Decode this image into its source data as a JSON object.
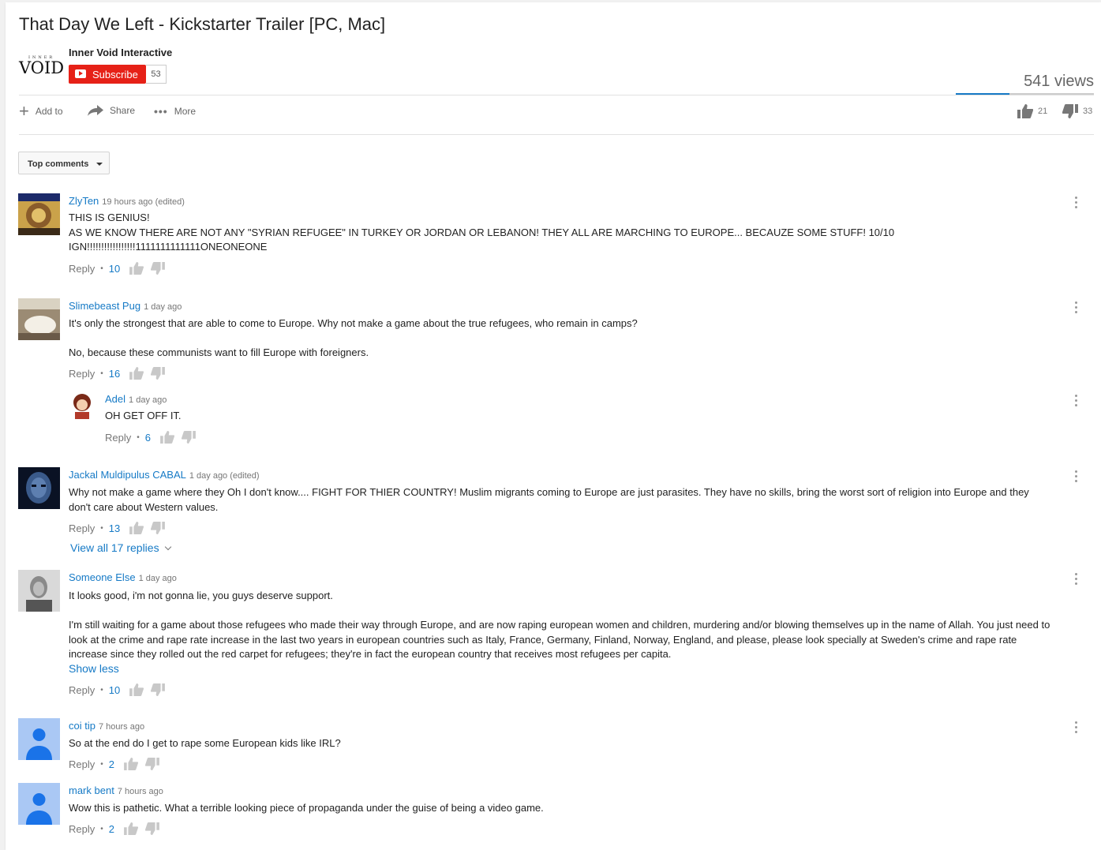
{
  "video": {
    "title": "That Day We Left - Kickstarter Trailer [PC, Mac]",
    "views": "541 views",
    "likes": "21",
    "dislikes": "33",
    "like_ratio": 0.39
  },
  "channel": {
    "name": "Inner Void Interactive",
    "logo_small": "INNER",
    "logo_word": "VOID",
    "subscribe_label": "Subscribe",
    "subscriber_count": "53"
  },
  "actions": {
    "add_to": "Add to",
    "share": "Share",
    "more": "More"
  },
  "sort": {
    "label": "Top comments"
  },
  "comments": [
    {
      "author": "ZlyTen",
      "time": "19 hours ago (edited)",
      "lines": [
        "THIS IS GENIUS!",
        "AS WE KNOW THERE ARE NOT ANY \"SYRIAN REFUGEE\" IN TURKEY OR JORDAN OR LEBANON! THEY ALL ARE MARCHING TO EUROPE... BECAUZE SOME STUFF! 10/10",
        "IGN!!!!!!!!!!!!!!!!!1111111111111ONEONEONE"
      ],
      "reply_label": "Reply",
      "likes": "10"
    },
    {
      "author": "Slimebeast Pug",
      "time": "1 day ago",
      "lines": [
        "It's only the strongest that are able to come to Europe. Why not make a game about the true refugees, who remain in camps?",
        "",
        "No, because these communists want to fill Europe with foreigners."
      ],
      "reply_label": "Reply",
      "likes": "16",
      "reply": {
        "author": "Adel",
        "time": "1 day ago",
        "text": "OH GET OFF IT.",
        "reply_label": "Reply",
        "likes": "6"
      }
    },
    {
      "author": "Jackal Muldipulus CABAL",
      "time": "1 day ago (edited)",
      "lines": [
        "Why not make a game where they Oh I don't know.... FIGHT FOR THIER COUNTRY! Muslim migrants coming to Europe are just parasites. They have no skills, bring the worst sort of religion into Europe and they don't care about Western values."
      ],
      "reply_label": "Reply",
      "likes": "13",
      "view_replies": "View all 17 replies"
    },
    {
      "author": "Someone Else",
      "time": "1 day ago",
      "lines": [
        "It looks good, i'm not gonna lie, you guys deserve support.",
        "",
        "I'm still waiting for a game about those refugees who made their way through Europe, and are now raping european women and children, murdering and/or blowing themselves up in the name of Allah. You just need to look at the crime and rape rate increase in the last two years in european countries such as Italy, France, Germany, Finland, Norway, England, and please, please look specially at Sweden's crime and rape rate increase since they rolled out the red carpet for refugees; they're in fact the european country that receives most refugees per capita."
      ],
      "show_less": "Show less",
      "reply_label": "Reply",
      "likes": "10"
    },
    {
      "author": "coi tip",
      "time": "7 hours ago",
      "lines": [
        "So at the end do I get to rape some European kids like IRL?"
      ],
      "reply_label": "Reply",
      "likes": "2"
    },
    {
      "author": "mark bent",
      "time": "7 hours ago",
      "lines": [
        "Wow this is pathetic. What a terrible looking piece of propaganda under the guise of being a video game."
      ],
      "reply_label": "Reply",
      "likes": "2"
    }
  ],
  "colors": {
    "accent": "#167ac6",
    "subscribe": "#e62117",
    "text": "#222222",
    "muted": "#767676"
  }
}
